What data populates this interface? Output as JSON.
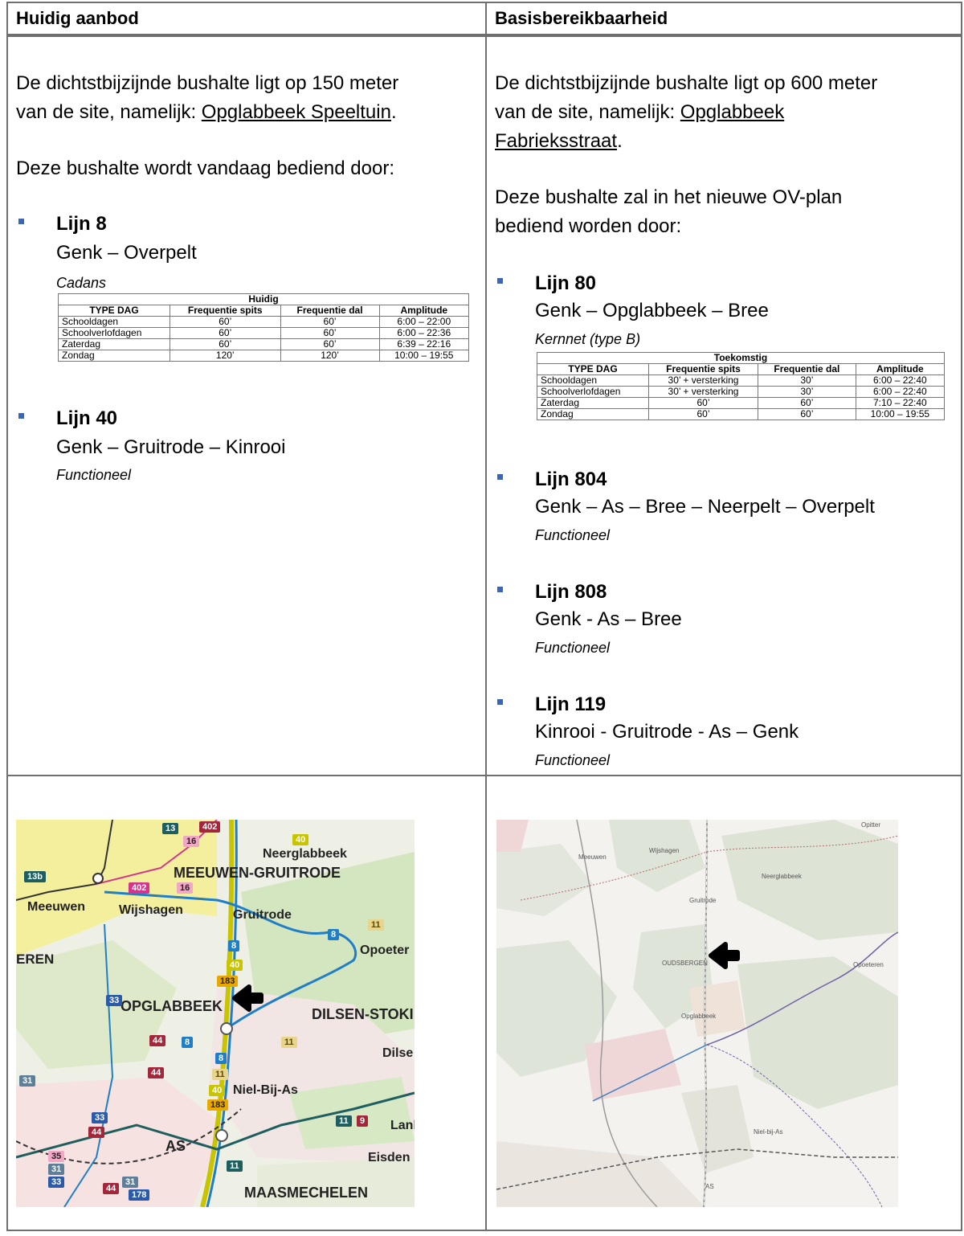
{
  "left": {
    "header": "Huidig aanbod",
    "p1_a": "De dichtstbijzijnde bushalte ligt op 150 meter",
    "p1_b": "van de site, namelijk: ",
    "p1_stop": "Opglabbeek Speeltuin",
    "p1_end": ".",
    "p2": "Deze bushalte wordt vandaag bediend door:",
    "lines": [
      {
        "name": "Lijn 8",
        "route": "Genk – Overpelt",
        "type": "Cadans"
      },
      {
        "name": "Lijn 40",
        "route": "Genk – Gruitrode – Kinrooi",
        "type": "Functioneel"
      }
    ],
    "table": {
      "title": "Huidig",
      "headers": [
        "TYPE DAG",
        "Frequentie spits",
        "Frequentie dal",
        "Amplitude"
      ],
      "rows": [
        [
          "Schooldagen",
          "60’",
          "60’",
          "6:00 – 22:00"
        ],
        [
          "Schoolverlofdagen",
          "60’",
          "60’",
          "6:00 – 22:36"
        ],
        [
          "Zaterdag",
          "60’",
          "60’",
          "6:39 – 22:16"
        ],
        [
          "Zondag",
          "120’",
          "120’",
          "10:00 – 19:55"
        ]
      ]
    },
    "map": {
      "labels": [
        "Neerglabbeek",
        "MEEUWEN-GRUITRODE",
        "Meeuwen",
        "Wijshagen",
        "Gruitrode",
        "Opoeter",
        "EREN",
        "OPGLABBEEK",
        "DILSEN-STOKI",
        "Dilse",
        "Niel-Bij-As",
        "Lank",
        "AS",
        "Eisden",
        "MAASMECHELEN"
      ],
      "badges": [
        "40",
        "13",
        "402",
        "16",
        "13b",
        "402",
        "16",
        "8",
        "11",
        "8",
        "40",
        "183",
        "33",
        "44",
        "8",
        "8",
        "11",
        "44",
        "11",
        "40",
        "183",
        "31",
        "33",
        "44",
        "11",
        "9",
        "35",
        "31",
        "44",
        "33",
        "31",
        "178",
        "11"
      ]
    }
  },
  "right": {
    "header": "Basisbereikbaarheid",
    "p1_a": "De dichtstbijzijnde bushalte ligt op 600 meter",
    "p1_b": "van de site, namelijk: ",
    "p1_stop_a": "Opglabbeek",
    "p1_stop_b": "Fabrieksstraat",
    "p1_end": ".",
    "p2_a": "Deze bushalte zal in het nieuwe OV-plan",
    "p2_b": "bediend worden door:",
    "lines": [
      {
        "name": "Lijn 80",
        "route": "Genk – Opglabbeek – Bree",
        "type": "Kernnet (type B)"
      },
      {
        "name": "Lijn 804",
        "route": "Genk – As – Bree – Neerpelt – Overpelt",
        "type": "Functioneel"
      },
      {
        "name": "Lijn 808",
        "route": "Genk - As – Bree",
        "type": "Functioneel"
      },
      {
        "name": "Lijn 119",
        "route": "Kinrooi - Gruitrode - As – Genk",
        "type": "Functioneel"
      }
    ],
    "table": {
      "title": "Toekomstig",
      "headers": [
        "TYPE DAG",
        "Frequentie spits",
        "Frequentie dal",
        "Amplitude"
      ],
      "rows": [
        [
          "Schooldagen",
          "30’ + versterking",
          "30’",
          "6:00 – 22:40"
        ],
        [
          "Schoolverlofdagen",
          "30’ + versterking",
          "30’",
          "6:00 – 22:40"
        ],
        [
          "Zaterdag",
          "60’",
          "60’",
          "7:10 – 22:40"
        ],
        [
          "Zondag",
          "60’",
          "60’",
          "10:00 – 19:55"
        ]
      ]
    },
    "map": {
      "labels": [
        "Opitter",
        "Wijshagen",
        "Meeuwen",
        "Neerglabbeek",
        "Gruitrode",
        "OUDSBERGEN",
        "Opoeteren",
        "Opglabbeek",
        "Niel-bij-As",
        "AS"
      ]
    }
  },
  "colors": {
    "bullet": "#3a67b5",
    "border": "#6f6f6f",
    "line8": "#1f7ec6",
    "line40": "#c8c400",
    "line183": "#e8a800",
    "arrow": "#000000"
  }
}
